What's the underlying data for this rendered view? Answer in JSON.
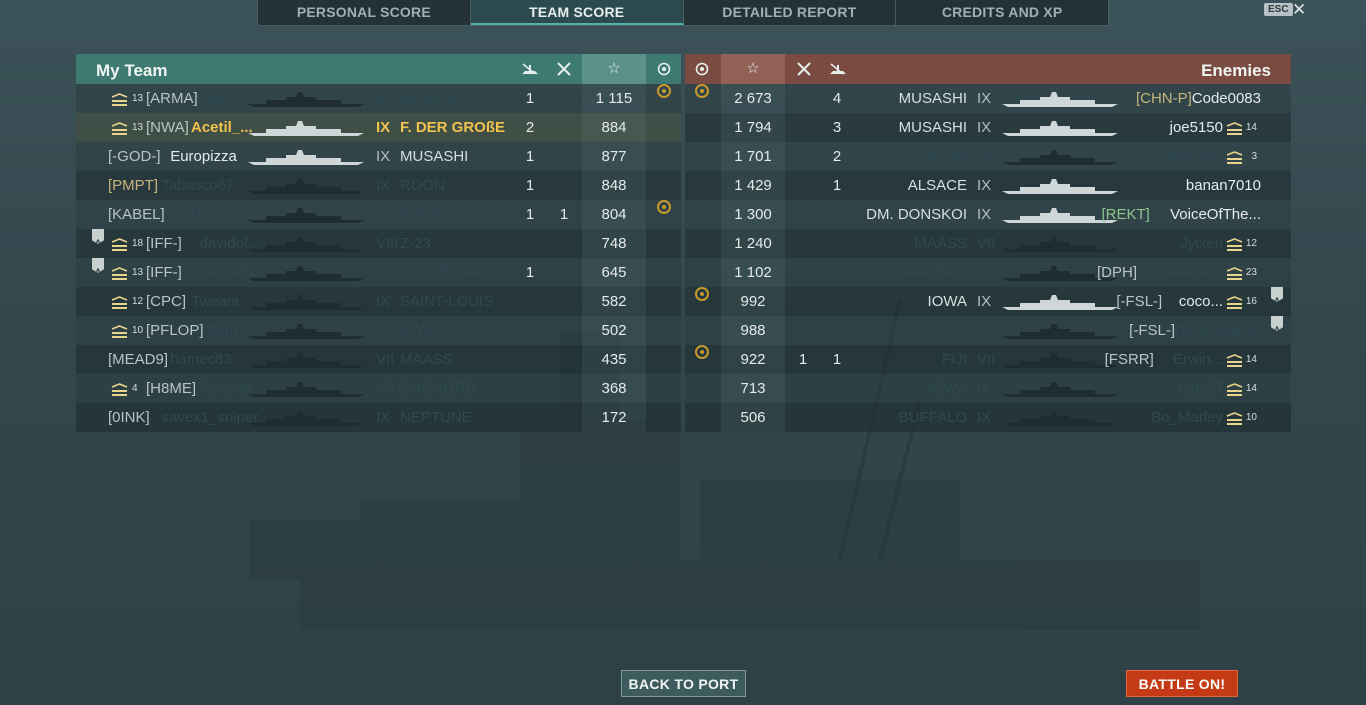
{
  "tabs": [
    "PERSONAL SCORE",
    "TEAM SCORE",
    "DETAILED REPORT",
    "CREDITS AND XP"
  ],
  "esc_label": "ESC",
  "close_glyph": "✕",
  "left_team": {
    "title": "My Team",
    "rows": [
      {
        "rank": "13",
        "clan": "[ARMA]",
        "name": "Tige...",
        "tier": "IX",
        "ship": "ALSACE",
        "k1": "1",
        "k2": "",
        "score": "1 115",
        "medal": true,
        "dim": true,
        "me": false,
        "abadge": false
      },
      {
        "rank": "13",
        "clan": "[NWA]",
        "name": "Acetil_...",
        "tier": "IX",
        "ship": "F. DER GROßE",
        "k1": "2",
        "k2": "",
        "score": "884",
        "medal": false,
        "dim": false,
        "me": true,
        "abadge": false
      },
      {
        "rank": "",
        "clan": "[-GOD-]",
        "name": "Europizza",
        "tier": "IX",
        "ship": "MUSASHI",
        "k1": "1",
        "k2": "",
        "score": "877",
        "medal": false,
        "dim": false,
        "me": false,
        "abadge": false
      },
      {
        "rank": "",
        "clan": "[PMPT]",
        "name": "Tabasco67",
        "tier": "IX",
        "ship": "ROON",
        "k1": "1",
        "k2": "",
        "score": "848",
        "medal": false,
        "dim": true,
        "me": false,
        "abadge": false,
        "clanColor": "gold"
      },
      {
        "rank": "",
        "clan": "[KABEL]",
        "name": "Un1kZ",
        "tier": "IX",
        "ship": "IOWA",
        "k1": "1",
        "k2": "1",
        "score": "804",
        "medal": true,
        "dim": true,
        "me": false,
        "abadge": false
      },
      {
        "rank": "18",
        "clan": "[IFF-]",
        "name": "davidof...",
        "tier": "VIII",
        "ship": "Z-23",
        "k1": "",
        "k2": "",
        "score": "748",
        "medal": false,
        "dim": true,
        "me": false,
        "abadge": true
      },
      {
        "rank": "13",
        "clan": "[IFF-]",
        "name": "sensei66",
        "tier": "VIII",
        "ship": "CLEVELAND",
        "k1": "1",
        "k2": "",
        "score": "645",
        "medal": false,
        "dim": true,
        "me": false,
        "abadge": true
      },
      {
        "rank": "12",
        "clan": "[CPC]",
        "name": "Tweani",
        "tier": "IX",
        "ship": "SAINT-LOUIS",
        "k1": "",
        "k2": "",
        "score": "582",
        "medal": false,
        "dim": true,
        "me": false,
        "abadge": false
      },
      {
        "rank": "10",
        "clan": "[PFLOP]",
        "name": "Item...",
        "tier": "IX",
        "ship": "IOWA",
        "k1": "",
        "k2": "",
        "score": "502",
        "medal": false,
        "dim": true,
        "me": false,
        "abadge": false
      },
      {
        "rank": "",
        "clan": "[MEAD9]",
        "name": "hamec83",
        "tier": "VII",
        "ship": "MAASS",
        "k1": "",
        "k2": "",
        "score": "435",
        "medal": false,
        "dim": true,
        "me": false,
        "abadge": false
      },
      {
        "rank": "4",
        "clan": "[H8ME]",
        "name": "Pyrome",
        "tier": "VII",
        "ship": "SHCHORS",
        "k1": "",
        "k2": "",
        "score": "368",
        "medal": false,
        "dim": true,
        "me": false,
        "abadge": false
      },
      {
        "rank": "",
        "clan": "[0INK]",
        "name": "savex1_sniper",
        "tier": "IX",
        "ship": "NEPTUNE",
        "k1": "",
        "k2": "",
        "score": "172",
        "medal": false,
        "dim": true,
        "me": false,
        "abadge": false
      }
    ]
  },
  "right_team": {
    "title": "Enemies",
    "rows": [
      {
        "medal": true,
        "score": "2 673",
        "k2": "",
        "k1": "4",
        "ship": "MUSASHI",
        "tier": "IX",
        "clan": "[CHN-P]",
        "name": "Code0083",
        "rank": "",
        "dim": false,
        "abadge": false,
        "clanColor": "gold"
      },
      {
        "medal": false,
        "score": "1 794",
        "k2": "",
        "k1": "3",
        "ship": "MUSASHI",
        "tier": "IX",
        "clan": "",
        "name": "joe5150",
        "rank": "14",
        "dim": false,
        "abadge": false
      },
      {
        "medal": false,
        "score": "1 701",
        "k2": "",
        "k1": "2",
        "ship": "ROON",
        "tier": "IX",
        "clan": "",
        "name": "fiamma91",
        "rank": "3",
        "dim": true,
        "abadge": false
      },
      {
        "medal": false,
        "score": "1 429",
        "k2": "",
        "k1": "1",
        "ship": "ALSACE",
        "tier": "IX",
        "clan": "",
        "name": "banan7010",
        "rank": "",
        "dim": false,
        "abadge": false
      },
      {
        "medal": false,
        "score": "1 300",
        "k2": "",
        "k1": "",
        "ship": "DM. DONSKOI",
        "tier": "IX",
        "clan": "[REKT]",
        "name": "VoiceOfThe...",
        "rank": "",
        "dim": false,
        "abadge": false,
        "clanColor": "green"
      },
      {
        "medal": false,
        "score": "1 240",
        "k2": "",
        "k1": "",
        "ship": "MAASS",
        "tier": "VII",
        "clan": "",
        "name": "Jyixen",
        "rank": "12",
        "dim": true,
        "abadge": false
      },
      {
        "medal": false,
        "score": "1 102",
        "k2": "",
        "k1": "",
        "ship": "KAGERO",
        "tier": "VIII",
        "clan": "[DPH]",
        "name": "ferkofr...",
        "rank": "23",
        "dim": true,
        "abadge": false
      },
      {
        "medal": true,
        "score": "992",
        "k2": "",
        "k1": "",
        "ship": "IOWA",
        "tier": "IX",
        "clan": "[-FSL-]",
        "name": "coco...",
        "rank": "16",
        "dim": false,
        "abadge": true
      },
      {
        "medal": false,
        "score": "988",
        "k2": "",
        "k1": "",
        "ship": "ATAGO",
        "tier": "VIII",
        "clan": "[-FSL-]",
        "name": "DeMoNlak38",
        "rank": "",
        "dim": true,
        "abadge": true
      },
      {
        "medal": true,
        "score": "922",
        "k2": "1",
        "k1": "1",
        "ship": "FIJI",
        "tier": "VII",
        "clan": "[FSRR]",
        "name": "Erwin...",
        "rank": "14",
        "dim": true,
        "abadge": false
      },
      {
        "medal": false,
        "score": "713",
        "k2": "",
        "k1": "",
        "ship": "IOWA",
        "tier": "IX",
        "clan": "",
        "name": "tedy57",
        "rank": "14",
        "dim": true,
        "abadge": false
      },
      {
        "medal": false,
        "score": "506",
        "k2": "",
        "k1": "",
        "ship": "BUFFALO",
        "tier": "IX",
        "clan": "",
        "name": "Bo_Marley",
        "rank": "10",
        "dim": true,
        "abadge": false
      }
    ]
  },
  "buttons": {
    "back": "BACK TO PORT",
    "battle": "BATTLE ON!"
  },
  "colors": {
    "ally_header": "#3e7a71",
    "enemy_header": "#7a4b40",
    "highlight": "#f2c24e",
    "battle_button": "#c33a14"
  }
}
